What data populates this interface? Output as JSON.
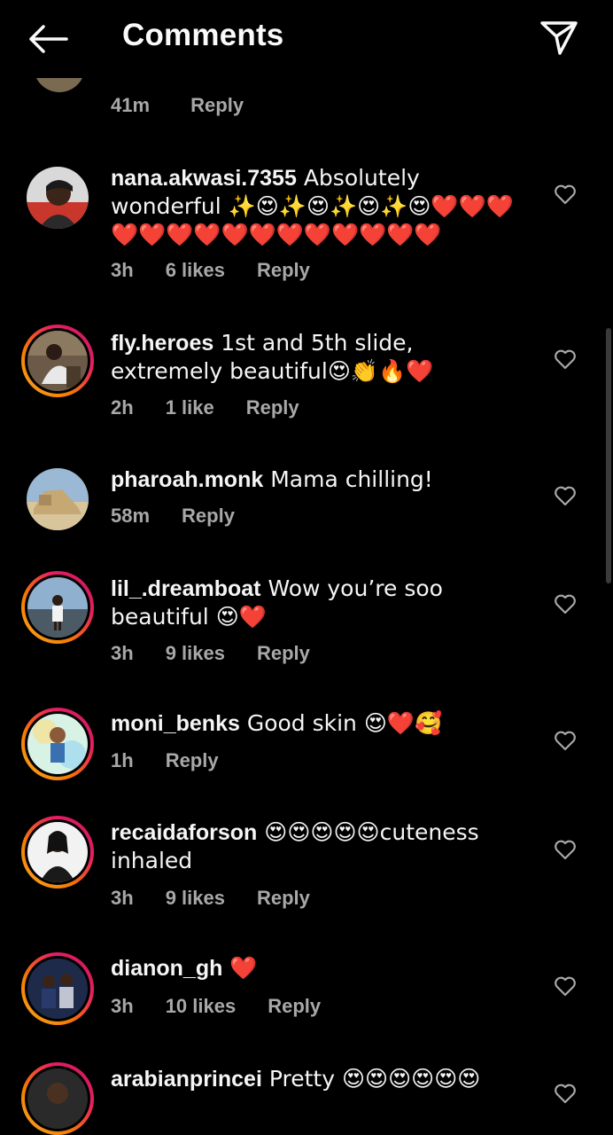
{
  "header": {
    "title": "Comments"
  },
  "top_partial": {
    "time": "41m",
    "reply": "Reply"
  },
  "comments": [
    {
      "username": "nana.akwasi.7355",
      "text": " Absolutely wonderful ✨😍✨😍✨😍✨😍❤️❤️❤️❤️❤️❤️❤️❤️❤️❤️❤️❤️❤️❤️❤️",
      "time": "3h",
      "likes": "6 likes",
      "reply": "Reply"
    },
    {
      "username": "fly.heroes",
      "text": " 1st and 5th slide, extremely beautiful😍👏🔥❤️",
      "time": "2h",
      "likes": "1 like",
      "reply": "Reply"
    },
    {
      "username": "pharoah.monk",
      "text": " Mama chilling!",
      "time": "58m",
      "likes": "",
      "reply": "Reply"
    },
    {
      "username": "lil_.dreamboat",
      "text": " Wow you’re soo beautiful 😍❤️",
      "time": "3h",
      "likes": "9 likes",
      "reply": "Reply"
    },
    {
      "username": "moni_benks",
      "text": " Good skin 😍❤️🥰",
      "time": "1h",
      "likes": "",
      "reply": "Reply"
    },
    {
      "username": "recaidaforson",
      "text": " 😍😍😍😍😍cuteness inhaled",
      "time": "3h",
      "likes": "9 likes",
      "reply": "Reply"
    },
    {
      "username": "dianon_gh",
      "text": " ❤️",
      "time": "3h",
      "likes": "10 likes",
      "reply": "Reply"
    },
    {
      "username": "arabianprincei",
      "text": " Pretty 😍😍😍😍😍😍",
      "time": "",
      "likes": "",
      "reply": ""
    }
  ],
  "icons": {
    "back": "arrow-left-icon",
    "share": "paper-plane-icon",
    "like": "heart-outline-icon"
  },
  "colors": {
    "background": "#000000",
    "text": "#f5f5f5",
    "meta": "#a8a8a8",
    "story_ring_start": "#f9a825",
    "story_ring_end": "#c2185b"
  }
}
